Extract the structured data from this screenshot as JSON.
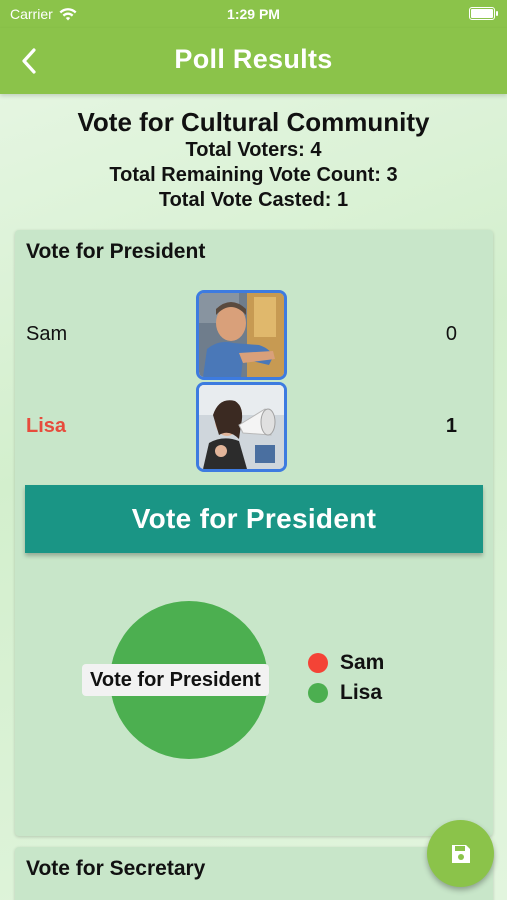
{
  "status_bar": {
    "carrier": "Carrier",
    "time": "1:29 PM"
  },
  "app_bar": {
    "title": "Poll Results",
    "back_icon": "chevron-left-icon"
  },
  "summary": {
    "poll_title": "Vote for Cultural Community",
    "total_voters": "Total Voters: 4",
    "remaining": "Total Remaining Vote Count: 3",
    "casted": "Total Vote Casted: 1"
  },
  "sections": [
    {
      "title": "Vote for President",
      "candidates": [
        {
          "name": "Sam",
          "votes": "0",
          "photo": "man-photo"
        },
        {
          "name": "Lisa",
          "votes": "1",
          "photo": "woman-megaphone-photo"
        }
      ],
      "vote_button": "Vote for President",
      "chart_label": "Vote for President"
    },
    {
      "title": "Vote for Secretary"
    }
  ],
  "chart_data": {
    "type": "pie",
    "title": "Vote for President",
    "categories": [
      "Sam",
      "Lisa"
    ],
    "values": [
      0,
      1
    ],
    "colors": [
      "#f44336",
      "#4caf50"
    ],
    "legend_position": "right"
  },
  "colors": {
    "primary": "#8bc34a",
    "vote_button": "#1a9585",
    "winner_text": "#e74c3c",
    "photo_border": "#3d7be0"
  },
  "fab": {
    "icon": "save-icon"
  }
}
